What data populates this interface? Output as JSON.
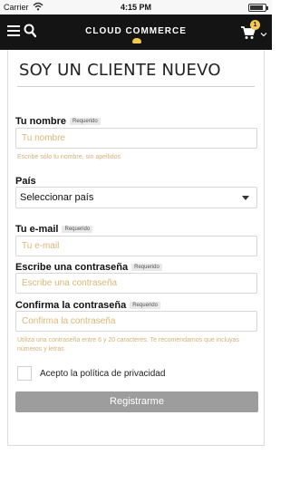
{
  "statusbar": {
    "carrier": "Carrier",
    "time": "4:15 PM",
    "battery_level": 0.9
  },
  "header": {
    "logo": "CLOUD COMMERCE",
    "cart_count": "1"
  },
  "form": {
    "title": "SOY UN CLIENTE NUEVO",
    "required_tag": "Requerido",
    "name": {
      "label": "Tu nombre",
      "placeholder": "Tu nombre",
      "hint": "Escribe sólo tu nombre, sin apellidos"
    },
    "country": {
      "label": "País",
      "value": "Seleccionar país"
    },
    "email": {
      "label": "Tu e-mail",
      "placeholder": "Tu e-mail"
    },
    "password": {
      "label": "Escribe una contraseña",
      "placeholder": "Escribe una contraseña"
    },
    "confirm": {
      "label": "Confirma la contraseña",
      "placeholder": "Confirma la contraseña",
      "hint": "Utiliza una contraseña entre 6 y 20 caracteres. Te recomendamos que incluyas números y letras"
    },
    "privacy_label": "Acepto la política de privacidad",
    "submit_label": "Registrarme"
  }
}
